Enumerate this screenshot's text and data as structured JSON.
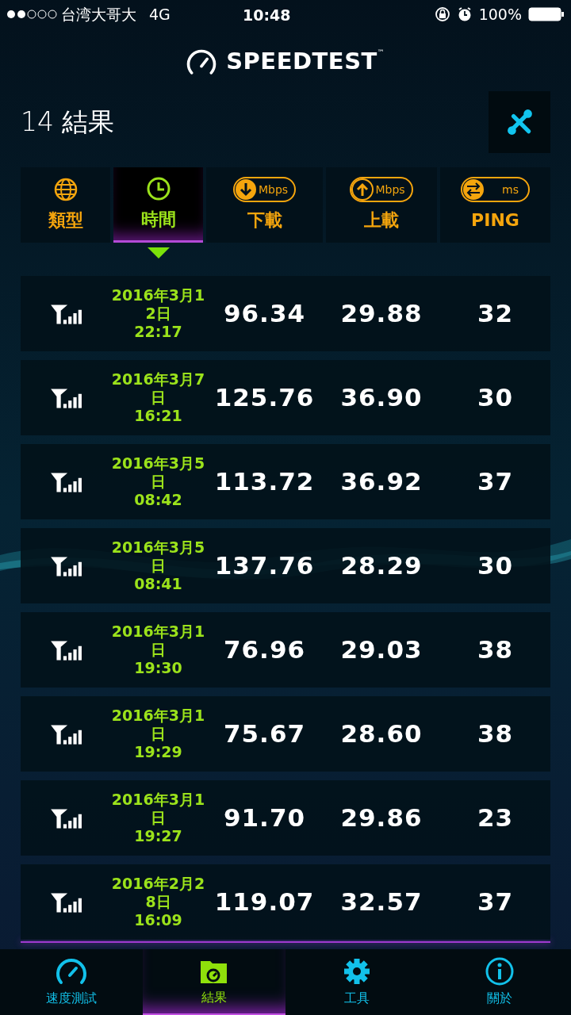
{
  "status_bar": {
    "carrier": "台湾大哥大",
    "network": "4G",
    "time": "10:48",
    "battery": "100%"
  },
  "header": {
    "logo": "SPEEDTEST",
    "trademark": "™"
  },
  "title": "14 結果",
  "columns": [
    {
      "kind": "type",
      "label": "類型",
      "selected": false
    },
    {
      "kind": "time",
      "label": "時間",
      "selected": true
    },
    {
      "kind": "download",
      "label": "下載",
      "unit": "Mbps",
      "selected": false
    },
    {
      "kind": "upload",
      "label": "上載",
      "unit": "Mbps",
      "selected": false
    },
    {
      "kind": "ping",
      "label": "PING",
      "unit": "ms",
      "selected": false
    }
  ],
  "results": [
    {
      "kind": "cellular",
      "date": "2016年3月12日",
      "time": "22:17",
      "download": "96.34",
      "upload": "29.88",
      "ping": "32"
    },
    {
      "kind": "cellular",
      "date": "2016年3月7日",
      "time": "16:21",
      "download": "125.76",
      "upload": "36.90",
      "ping": "30"
    },
    {
      "kind": "cellular",
      "date": "2016年3月5日",
      "time": "08:42",
      "download": "113.72",
      "upload": "36.92",
      "ping": "37"
    },
    {
      "kind": "cellular",
      "date": "2016年3月5日",
      "time": "08:41",
      "download": "137.76",
      "upload": "28.29",
      "ping": "30"
    },
    {
      "kind": "cellular",
      "date": "2016年3月1日",
      "time": "19:30",
      "download": "76.96",
      "upload": "29.03",
      "ping": "38"
    },
    {
      "kind": "cellular",
      "date": "2016年3月1日",
      "time": "19:29",
      "download": "75.67",
      "upload": "28.60",
      "ping": "38"
    },
    {
      "kind": "cellular",
      "date": "2016年3月1日",
      "time": "19:27",
      "download": "91.70",
      "upload": "29.86",
      "ping": "23"
    },
    {
      "kind": "cellular",
      "date": "2016年2月28日",
      "time": "16:09",
      "download": "119.07",
      "upload": "32.57",
      "ping": "37"
    }
  ],
  "tabs": [
    {
      "kind": "speed",
      "label": "速度測試",
      "selected": false
    },
    {
      "kind": "results",
      "label": "結果",
      "selected": true
    },
    {
      "kind": "tools",
      "label": "工具",
      "selected": false
    },
    {
      "kind": "about",
      "label": "關於",
      "selected": false
    }
  ]
}
